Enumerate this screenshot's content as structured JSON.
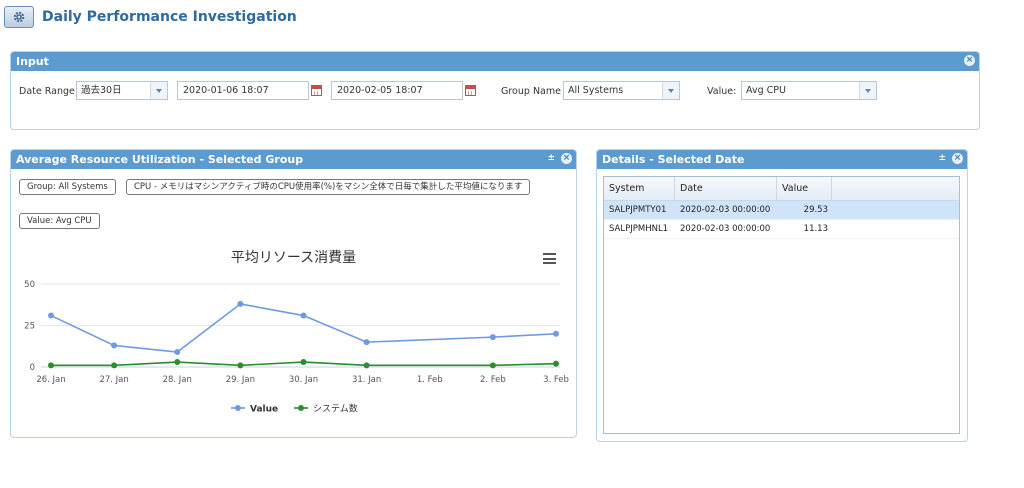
{
  "app": {
    "title": "Daily Performance Investigation"
  },
  "input_panel": {
    "title": "Input",
    "date_range_label": "Date Range",
    "date_range_value": "過去30日",
    "start_date": "2020-01-06 18:07",
    "end_date": "2020-02-05 18:07",
    "group_name_label": "Group Name",
    "group_name_value": "All Systems",
    "value_label": "Value:",
    "value_value": "Avg CPU"
  },
  "util_panel": {
    "title": "Average Resource Utilization - Selected Group",
    "tag_group": "Group: All Systems",
    "tag_note": "CPU - メモリはマシンアクティブ時のCPU使用率(%)をマシン全体で日毎で集計した平均値になります",
    "tag_value": "Value: Avg CPU"
  },
  "chart_data": {
    "type": "line",
    "title": "平均リソース消費量",
    "x": [
      "26. Jan",
      "27. Jan",
      "28. Jan",
      "29. Jan",
      "30. Jan",
      "31. Jan",
      "1. Feb",
      "2. Feb",
      "3. Feb"
    ],
    "y_ticks": [
      0,
      25,
      50
    ],
    "ylim": [
      0,
      50
    ],
    "grid": true,
    "legend_position": "bottom-center",
    "series": [
      {
        "name": "Value",
        "color": "#6f9ae0",
        "points": [
          [
            0,
            31
          ],
          [
            1,
            13
          ],
          [
            2,
            9
          ],
          [
            3,
            38
          ],
          [
            4,
            31
          ],
          [
            5,
            15
          ],
          [
            7,
            18
          ],
          [
            8,
            20
          ]
        ]
      },
      {
        "name": "システム数",
        "color": "#2e8b2e",
        "points": [
          [
            0,
            1
          ],
          [
            1,
            1
          ],
          [
            2,
            3
          ],
          [
            3,
            1
          ],
          [
            4,
            3
          ],
          [
            5,
            1
          ],
          [
            7,
            1
          ],
          [
            8,
            2
          ]
        ]
      }
    ]
  },
  "details_panel": {
    "title": "Details - Selected Date",
    "columns": [
      "System",
      "Date",
      "Value"
    ],
    "rows": [
      {
        "system": "SALPJPMTY01",
        "date": "2020-02-03 00:00:00",
        "value": "29.53",
        "selected": true
      },
      {
        "system": "SALPJPMHNL1",
        "date": "2020-02-03 00:00:00",
        "value": "11.13",
        "selected": false
      }
    ]
  },
  "colors": {
    "panel_header": "#5b9bd0",
    "title_text": "#2f6a9f"
  }
}
